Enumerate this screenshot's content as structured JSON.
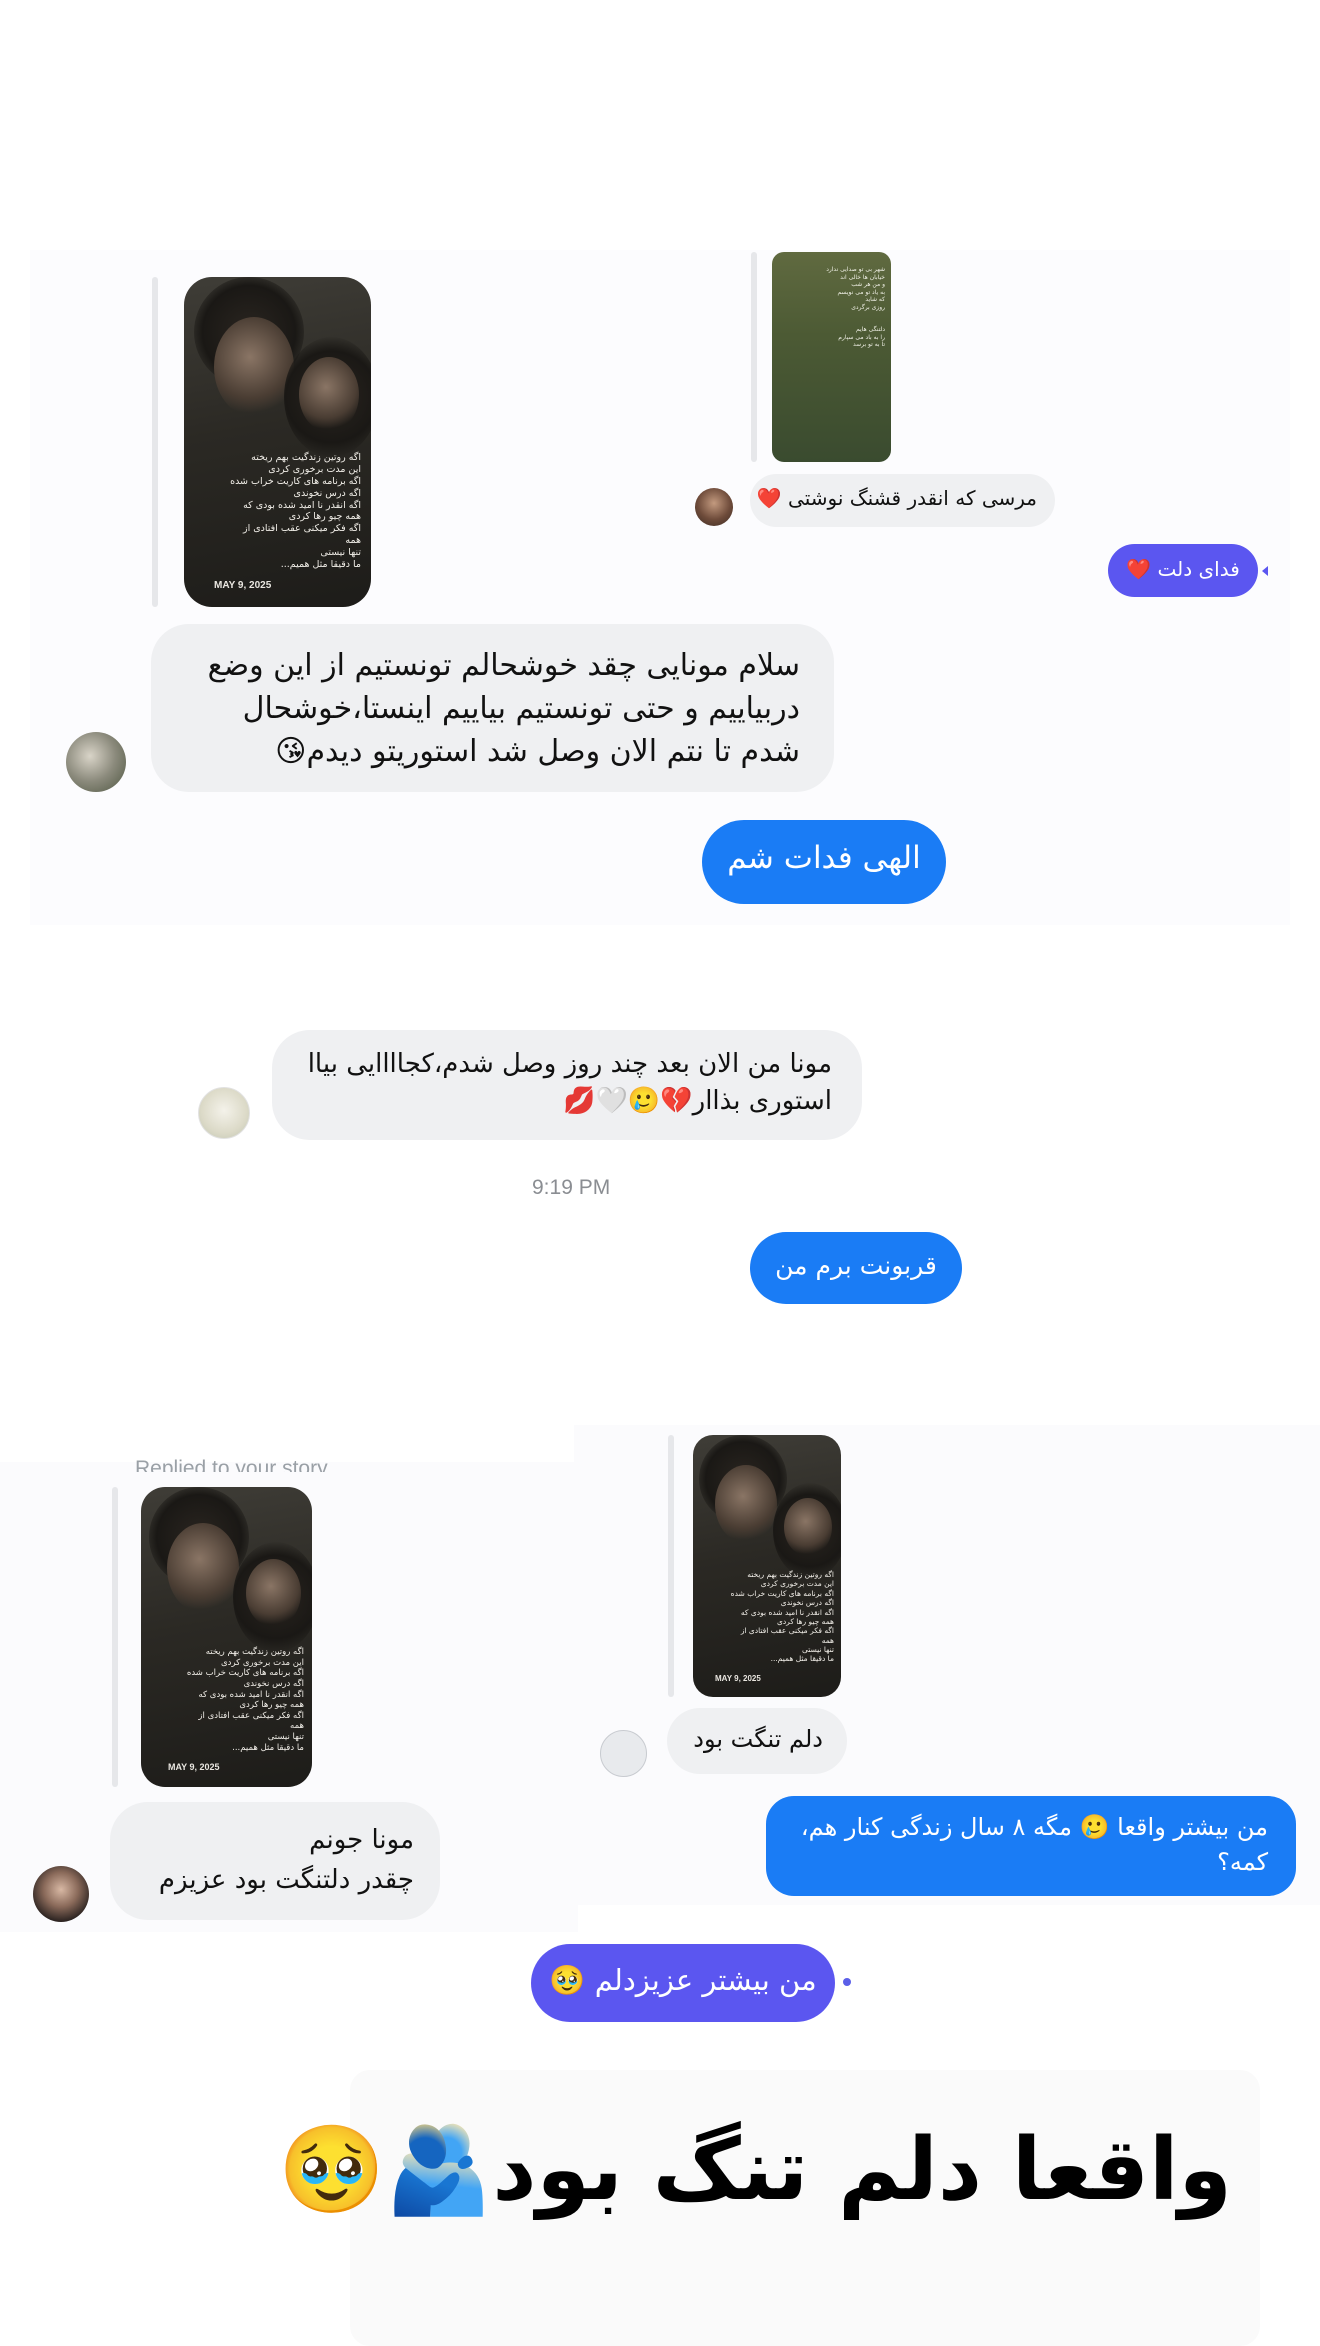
{
  "screenshot_1": {
    "story_left": {
      "poem": "اگه روتین زندگیت بهم ریخته\nاین مدت برخوری کردی\nاگه برنامه های کاریت خراب شده\nاگه درس نخوندی\nاگه انقدر نا امید شده بودی که\nهمه چیو رها کردی\nاگه فکر میکنی عقب افتادی از\nهمه\nتنها نیستی\nما دقیقا مثل همیم...",
      "date": "MAY 9, 2025"
    },
    "story_right": {
      "poem": "شهر بی تو صدایی ندارد\nخیابان ها خالی اند\nو من هر شب\nبه یاد تو می نویسم\nکه شاید\nروزی برگردی\n\n\nدلتنگی هایم\nرا به باد می سپارم\nتا به تو برسد"
    },
    "incoming_short": "مرسی که انقدر قشنگ نوشتی",
    "incoming_short_emoji": "❤️",
    "outgoing_small": "فدای دلت",
    "outgoing_small_emoji": "❤️",
    "incoming_long": "سلام مونایی چقد خوشحالم تونستیم از این وضع دربیاییم و حتی تونستیم بیاییم اینستا،خوشحال شدم تا نتم الان وصل شد استوریتو دیدم",
    "incoming_long_emoji": "😘",
    "outgoing_large": "الهی فدات شم"
  },
  "screenshot_2": {
    "incoming": "مونا من الان بعد چند روز وصل شدم،کجاااایی بیاا استوری بذاار",
    "incoming_emoji": "💔🥲🤍💋",
    "time": "9:19 PM",
    "outgoing": "قربونت برم من"
  },
  "screenshot_3": {
    "reply_label": "Replied to your story",
    "story": {
      "poem": "اگه روتین زندگیت بهم ریخته\nاین مدت برخوری کردی\nاگه برنامه های کاریت خراب شده\nاگه درس نخوندی\nاگه انقدر نا امید شده بودی که\nهمه چیو رها کردی\nاگه فکر میکنی عقب افتادی از\nهمه\nتنها نیستی\nما دقیقا مثل همیم...",
      "date": "MAY 9, 2025"
    },
    "incoming_line1": "مونا جونم",
    "incoming_line2": "چقدر دلتنگت بود عزیزم"
  },
  "screenshot_4": {
    "story": {
      "poem": "اگه روتین زندگیت بهم ریخته\nاین مدت برخوری کردی\nاگه برنامه های کاریت خراب شده\nاگه درس نخوندی\nاگه انقدر نا امید شده بودی که\nهمه چیو رها کردی\nاگه فکر میکنی عقب افتادی از\nهمه\nتنها نیستی\nما دقیقا مثل همیم...",
      "date": "MAY 9, 2025"
    },
    "incoming": "دلم تنگت بود",
    "outgoing_text": "من بیشتر واقعا 🥲 مگه ۸ سال زندگی کنار هم، کمه؟"
  },
  "screenshot_5": {
    "outgoing": "من بیشتر عزیزدلم",
    "outgoing_emoji": "🥹"
  },
  "caption": {
    "text": "واقعا دلم تنگ بود",
    "emoji": "🫂🥹"
  },
  "colors": {
    "blue": "#1a7cf5",
    "indigo": "#5b56f0",
    "bubble_gray": "#eff0f2"
  }
}
